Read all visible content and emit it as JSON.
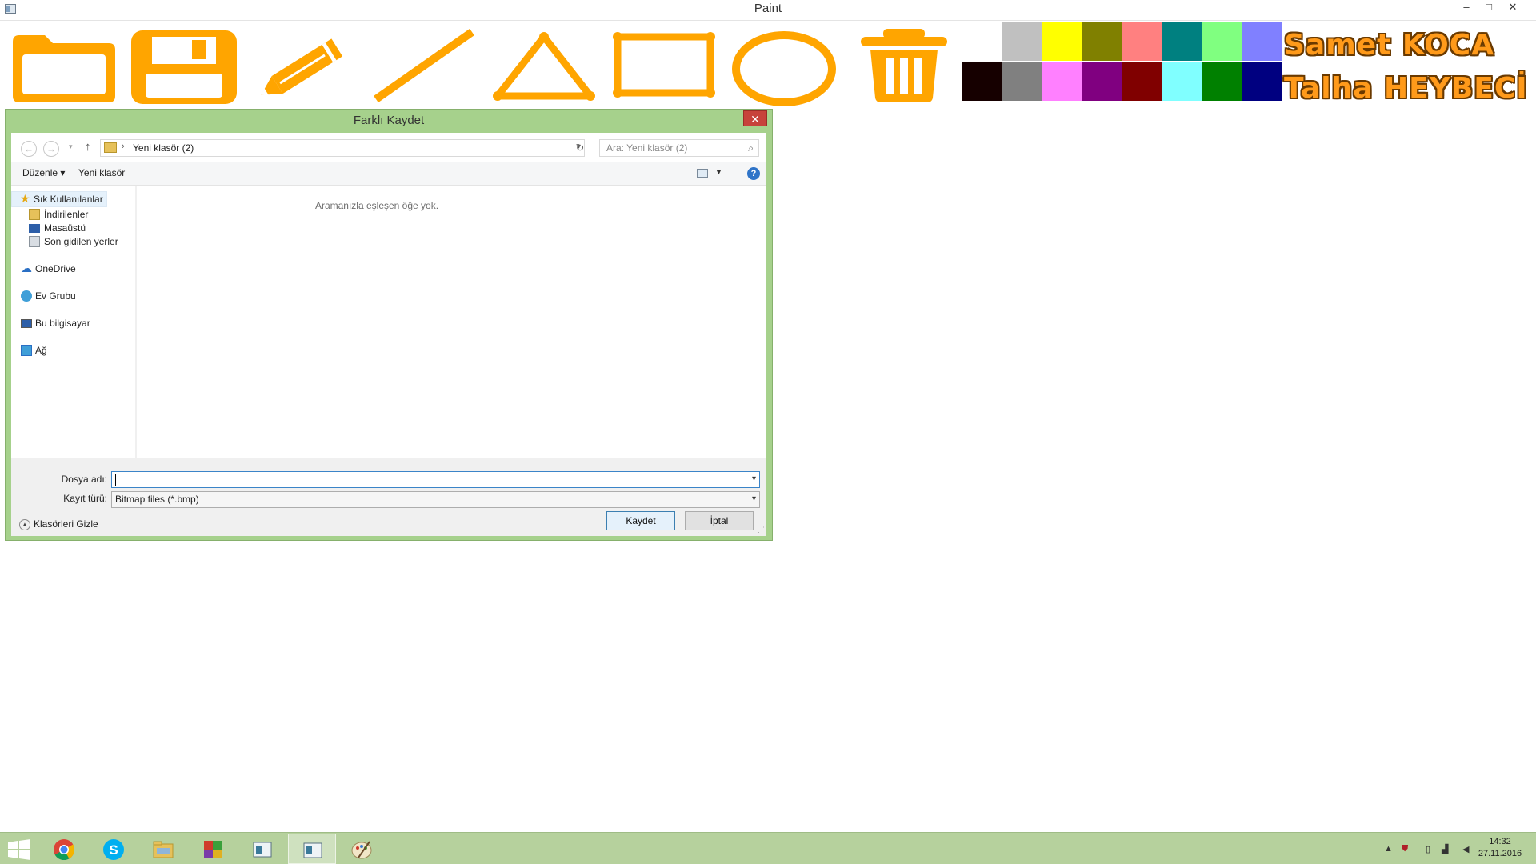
{
  "app": {
    "title": "Paint",
    "minimize_glyph": "–",
    "maximize_glyph": "□",
    "close_glyph": "✕"
  },
  "toolbar": {
    "tools": [
      {
        "name": "open-folder-icon"
      },
      {
        "name": "save-floppy-icon"
      },
      {
        "name": "pencil-icon"
      },
      {
        "name": "line-tool-icon"
      },
      {
        "name": "triangle-tool-icon"
      },
      {
        "name": "rectangle-tool-icon"
      },
      {
        "name": "ellipse-tool-icon"
      },
      {
        "name": "trash-icon"
      }
    ],
    "accent_color": "#ffa500"
  },
  "palette": {
    "top_row": [
      "#ffffff",
      "#c0c0c0",
      "#ffff00",
      "#808000",
      "#ff8080",
      "#008080",
      "#80ff80",
      "#8080ff"
    ],
    "bottom_row": [
      "#160000",
      "#808080",
      "#ff80ff",
      "#800080",
      "#800000",
      "#80ffff",
      "#008000",
      "#000080"
    ]
  },
  "authors": {
    "first": "Samet KOCA",
    "second": "Talha HEYBECİ"
  },
  "dialog": {
    "title": "Farklı Kaydet",
    "close_glyph": "✕",
    "address_path": "Yeni klasör (2)",
    "search_placeholder": "Ara: Yeni klasör (2)",
    "commands": {
      "organize": "Düzenle ▾",
      "new_folder": "Yeni klasör"
    },
    "nav": {
      "favorites": "Sık Kullanılanlar",
      "downloads": "İndirilenler",
      "desktop": "Masaüstü",
      "recent": "Son gidilen yerler",
      "onedrive": "OneDrive",
      "homegroup": "Ev Grubu",
      "this_pc": "Bu bilgisayar",
      "network": "Ağ"
    },
    "empty_message": "Aramanızla eşleşen öğe yok.",
    "filename_label": "Dosya adı:",
    "filename_value": "",
    "filetype_label": "Kayıt türü:",
    "filetype_value": "Bitmap files (*.bmp)",
    "hide_folders": "Klasörleri Gizle",
    "save_button": "Kaydet",
    "cancel_button": "İptal"
  },
  "taskbar": {
    "apps": [
      "chrome",
      "skype",
      "file-explorer",
      "winrar",
      "app-window-1",
      "app-window-2",
      "paint-app"
    ],
    "clock_time": "14:32",
    "clock_date": "27.11.2016"
  }
}
